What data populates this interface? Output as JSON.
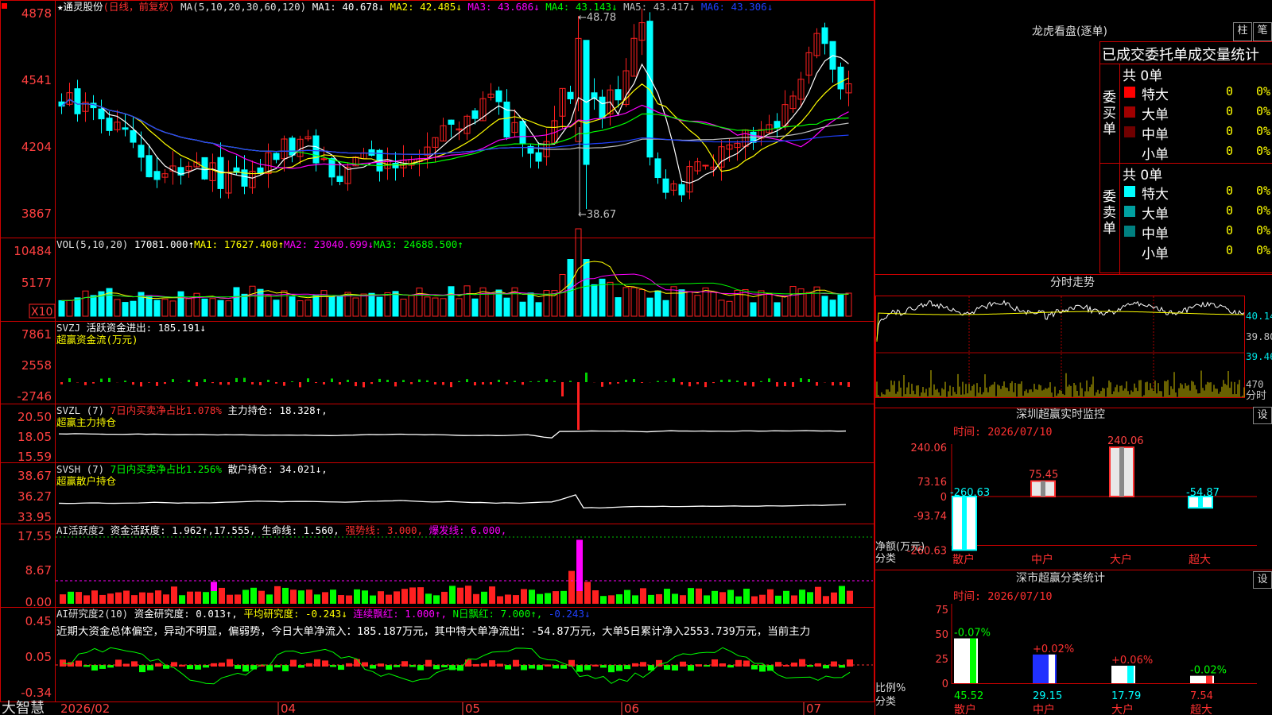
{
  "colors": {
    "up": "#ff2020",
    "down": "#00ffff",
    "border": "#cc0000",
    "axis": "#ff4040",
    "white": "#ffffff",
    "yellow": "#ffff00",
    "magenta": "#ff00ff",
    "green": "#00ff00",
    "gray": "#c0c0c0"
  },
  "main": {
    "title": "★通灵股份",
    "mode": "(日线，前复权)",
    "ma": {
      "head": "MA(5,10,20,30,60,120)",
      "l1": "MA1: 40.678↓",
      "l2": "MA2: 42.485↓",
      "l3": "MA3: 43.686↓",
      "l4": "MA4: 43.143↓",
      "l5": "MA5: 43.417↓",
      "l6": "MA6: 43.306↓"
    },
    "yticks": [
      "4878",
      "4541",
      "4204",
      "3867"
    ],
    "hi": "←48.78",
    "lo": "←38.67"
  },
  "vol": {
    "head": "VOL(5,10,20)",
    "v": "17081.000↑",
    "ma1": "MA1: 17627.400↑",
    "ma2": "MA2: 23040.699↓",
    "ma3": "MA3: 24688.500↑",
    "yticks": [
      "10484",
      "5177"
    ],
    "unit": "X10"
  },
  "svzj": {
    "head": "SVZJ",
    "label": "活跃资金进出:",
    "val": "185.191↓",
    "sub": "超赢资金流(万元)",
    "yticks": [
      "7861",
      "2558",
      "-2746"
    ]
  },
  "svzl": {
    "head": "SVZL (7)",
    "pct": "7日内买卖净占比1.078%",
    "main": "主力持仓: 18.328↑,",
    "sub": "超赢主力持仓",
    "yticks": [
      "20.50",
      "18.05",
      "15.59"
    ]
  },
  "svsh": {
    "head": "SVSH (7)",
    "pct": "7日内买卖净占比1.256%",
    "retail": "散户持仓: 34.021↓,",
    "sub": "超赢散户持仓",
    "yticks": [
      "38.67",
      "36.27",
      "33.95"
    ]
  },
  "ai1": {
    "head": "AI活跃度2",
    "act": "资金活跃度: 1.962↑,",
    "v2": "17.555,",
    "life": "生命线: 1.560,",
    "strong": "强势线: 3.000,",
    "burst": "爆发线: 6.000,",
    "yticks": [
      "17.55",
      "8.67",
      "0.00"
    ]
  },
  "ai2": {
    "head": "AI研究度2(10)",
    "r1": "资金研究度: 0.013↑,",
    "r2": "平均研究度: -0.243↓",
    "r3": "连续飘红: 1.000↑,",
    "r4": "N日飘红: 7.000↑,",
    "r5": "-0.243↓",
    "comment": "近期大资金总体偏空，异动不明显，偏弱势，今日大单净流入：185.187万元，其中特大单净流出：-54.87万元，大单5日累计净入2553.739万元，当前主力",
    "yticks": [
      "0.45",
      "0.05",
      "-0.34"
    ]
  },
  "xaxis": {
    "brand": "大智慧",
    "labels": [
      "2026/02",
      "04",
      "05",
      "06",
      "07"
    ]
  },
  "lhb": {
    "title": "龙虎看盘(逐单)",
    "tab1": "柱",
    "tab2": "笔",
    "cols": "已成交委托单成交量统计",
    "buy": {
      "side": "委买单",
      "total": "共 0单",
      "rows": [
        {
          "name": "特大",
          "v": "0",
          "p": "0%",
          "c": "#ff0000"
        },
        {
          "name": "大单",
          "v": "0",
          "p": "0%",
          "c": "#a00000"
        },
        {
          "name": "中单",
          "v": "0",
          "p": "0%",
          "c": "#700000"
        },
        {
          "name": "小单",
          "v": "0",
          "p": "0%",
          "c": ""
        }
      ]
    },
    "sell": {
      "side": "委卖单",
      "total": "共 0单",
      "rows": [
        {
          "name": "特大",
          "v": "0",
          "p": "0%",
          "c": "#00ffff"
        },
        {
          "name": "大单",
          "v": "0",
          "p": "0%",
          "c": "#00a0a0"
        },
        {
          "name": "中单",
          "v": "0",
          "p": "0%",
          "c": "#008080"
        },
        {
          "name": "小单",
          "v": "0",
          "p": "0%",
          "c": ""
        }
      ]
    }
  },
  "fs": {
    "title": "分时走势",
    "p1": "40.14",
    "p2": "39.80",
    "p3": "39.46",
    "v": "470",
    "vl": "分时"
  },
  "sz": {
    "title": "深圳超赢实时监控",
    "set": "设",
    "time": "时间: 2026/07/10",
    "yticks": [
      "240.06",
      "73.16",
      "0",
      "-93.74",
      "-260.63"
    ],
    "ylab1": "净额(万元)",
    "ylab2": "分类",
    "bars": [
      {
        "cat": "散户",
        "label": "-260.63",
        "v": -260.63
      },
      {
        "cat": "中户",
        "label": "75.45",
        "v": 75.45
      },
      {
        "cat": "大户",
        "label": "240.06",
        "v": 240.06
      },
      {
        "cat": "超大",
        "label": "-54.87",
        "v": -54.87
      }
    ]
  },
  "fl": {
    "title": "深市超赢分类统计",
    "set": "设",
    "time": "时间: 2026/07/10",
    "yticks": [
      "75",
      "50",
      "25",
      "0"
    ],
    "ylab1": "比例%",
    "ylab2": "分类",
    "bars": [
      {
        "cat": "散户",
        "pct": "-0.07%",
        "val": "45.52",
        "v": 45.52
      },
      {
        "cat": "中户",
        "pct": "+0.02%",
        "val": "29.15",
        "v": 29.15
      },
      {
        "cat": "大户",
        "pct": "+0.06%",
        "val": "17.79",
        "v": 17.79
      },
      {
        "cat": "超大",
        "pct": "-0.02%",
        "val": "7.54",
        "v": 7.54
      }
    ]
  }
}
